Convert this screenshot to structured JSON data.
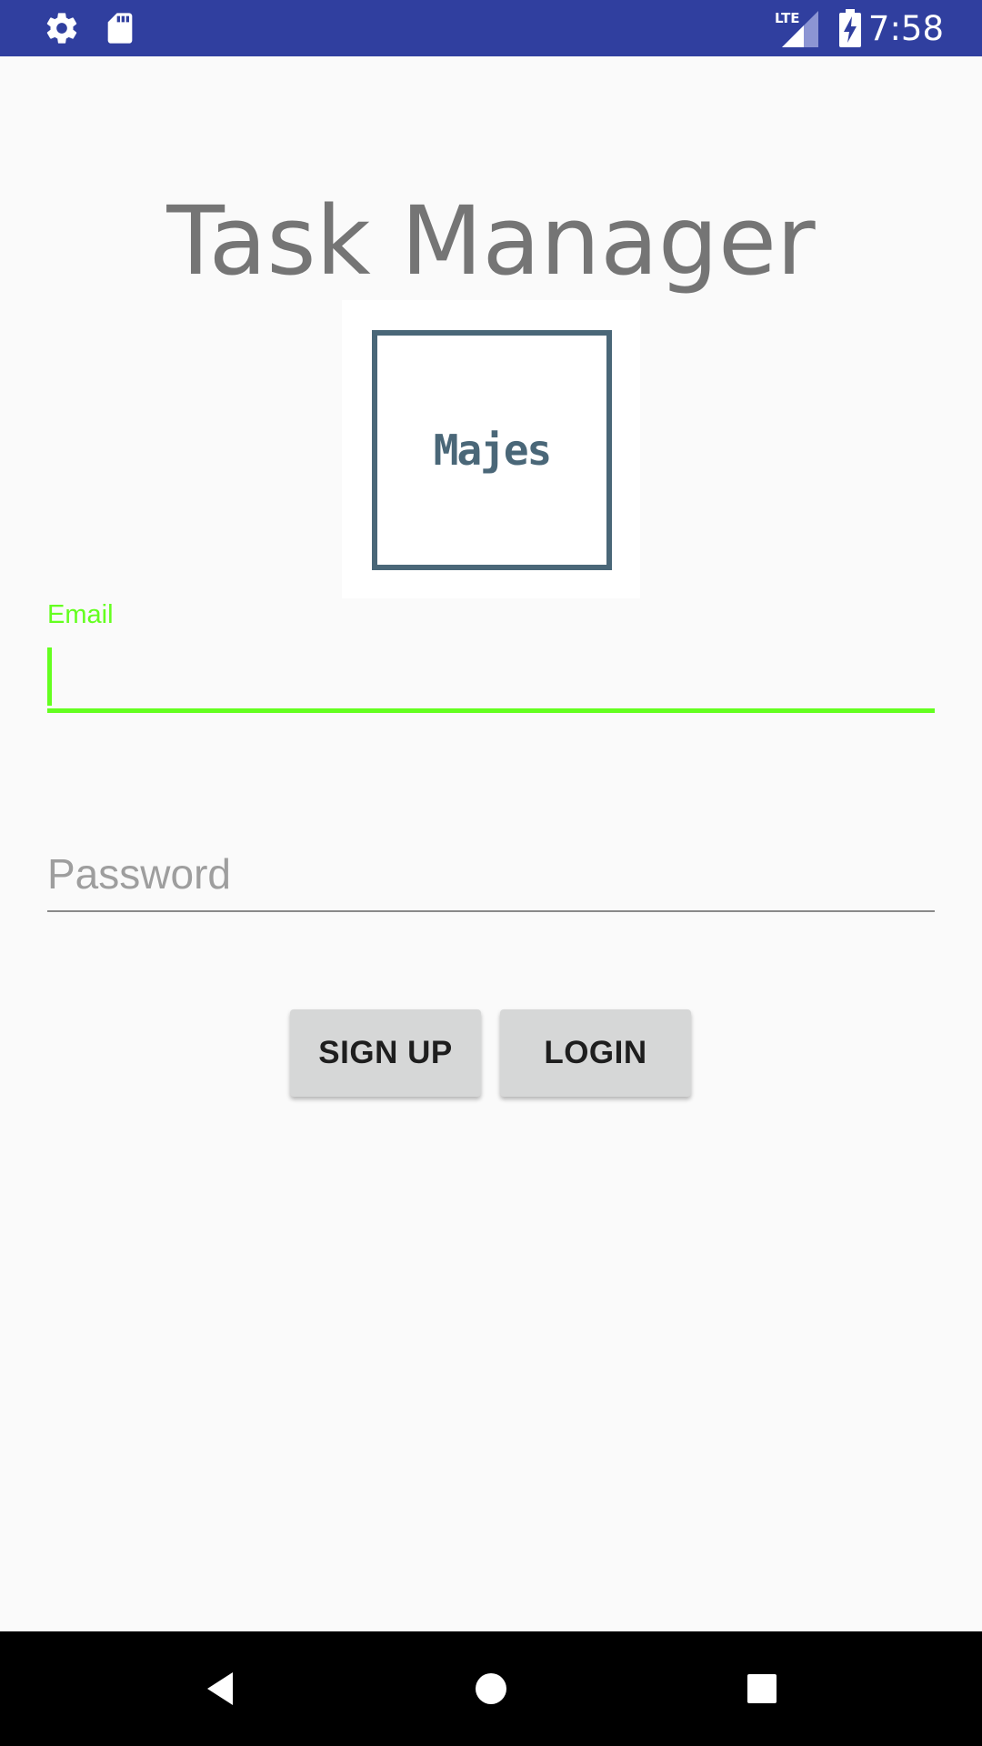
{
  "status_bar": {
    "time": "7:58",
    "left_icons": [
      "gear-icon",
      "sd-card-icon"
    ],
    "right_icons": [
      "lte-signal-icon",
      "battery-charging-icon"
    ],
    "lte_label": "LTE",
    "background_color": "#303f9f"
  },
  "app": {
    "title": "Task Manager",
    "logo_text": "Majes"
  },
  "form": {
    "email": {
      "label": "Email",
      "value": "",
      "accent_color": "#64ff1f"
    },
    "password": {
      "placeholder": "Password",
      "value": ""
    }
  },
  "buttons": {
    "sign_up": "SIGN UP",
    "login": "LOGIN"
  },
  "nav_bar": {
    "icons": [
      "back-icon",
      "home-icon",
      "recents-icon"
    ]
  }
}
